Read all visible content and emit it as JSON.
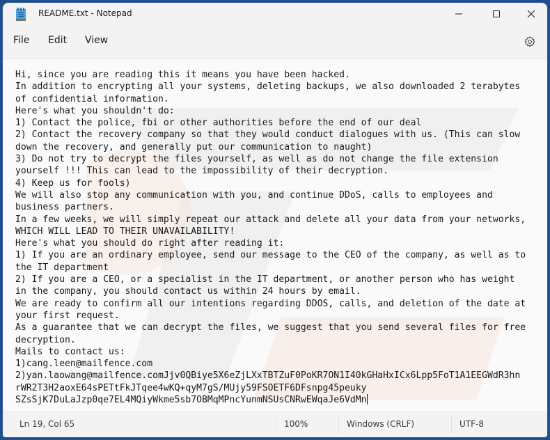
{
  "window": {
    "title": "README.txt - Notepad",
    "app_icon": "notepad-icon",
    "controls": {
      "minimize": "minimize-icon",
      "maximize": "maximize-icon",
      "close": "close-icon"
    }
  },
  "menu": {
    "items": [
      {
        "label": "File"
      },
      {
        "label": "Edit"
      },
      {
        "label": "View"
      }
    ],
    "settings_icon": "gear-icon"
  },
  "editor": {
    "lines": [
      "Hi, since you are reading this it means you have been hacked.",
      "In addition to encrypting all your systems, deleting backups, we also downloaded 2 terabytes",
      "of confidential information.",
      "Here's what you shouldn't do:",
      "1) Contact the police, fbi or other authorities before the end of our deal",
      "2) Contact the recovery company so that they would conduct dialogues with us. (This can slow",
      "down the recovery, and generally put our communication to naught)",
      "3) Do not try to decrypt the files yourself, as well as do not change the file extension",
      "yourself !!! This can lead to the impossibility of their decryption.",
      "4) Keep us for fools)",
      "We will also stop any communication with you, and continue DDoS, calls to employees and",
      "business partners.",
      "In a few weeks, we will simply repeat our attack and delete all your data from your networks,",
      "WHICH WILL LEAD TO THEIR UNAVAILABILITY!",
      "Here's what you should do right after reading it:",
      "1) If you are an ordinary employee, send our message to the CEO of the company, as well as to",
      "the IT department",
      "2) If you are a CEO, or a specialist in the IT department, or another person who has weight",
      "in the company, you should contact us within 24 hours by email.",
      "We are ready to confirm all our intentions regarding DDOS, calls, and deletion of the date at",
      "your first request.",
      "As a guarantee that we can decrypt the files, we suggest that you send several files for free",
      "decryption.",
      "Mails to contact us:",
      "1)cang.leen@mailfence.com",
      "2)yan.laowang@mailfence.comJjv0QBiye5X6eZjLXxTBTZuF0PoKR7ON1I40kGHaHxICx6Lpp5FoT1A1EEGWdR3hn",
      "rWR2T3H2aoxE64sPETtFkJTqee4wKQ+qyM7gS/MUjy59FSOETF6DFsnpg45peuky",
      "SZsSjK7DuLaJzp0qe7EL4MQiyWkme5sb7OBMqMPncYunmNSUsCNRwEWqaJe6VdMn"
    ]
  },
  "status": {
    "position": "Ln 19, Col 65",
    "zoom": "100%",
    "line_ending": "Windows (CRLF)",
    "encoding": "UTF-8"
  }
}
